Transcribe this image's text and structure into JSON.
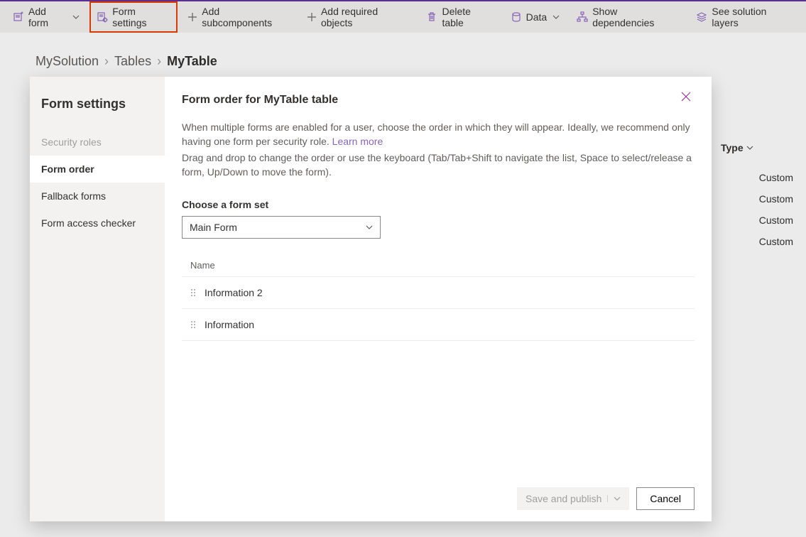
{
  "commandBar": {
    "addForm": "Add form",
    "formSettings": "Form settings",
    "addSubcomponents": "Add subcomponents",
    "addRequiredObjects": "Add required objects",
    "deleteTable": "Delete table",
    "data": "Data",
    "showDependencies": "Show dependencies",
    "seeSolutionLayers": "See solution layers"
  },
  "breadcrumb": {
    "root": "MySolution",
    "mid": "Tables",
    "current": "MyTable"
  },
  "bgTable": {
    "typeHeader": "Type",
    "rows": [
      "Custom",
      "Custom",
      "Custom",
      "Custom"
    ]
  },
  "dialog": {
    "sidebarTitle": "Form settings",
    "sideItems": {
      "security": "Security roles",
      "formOrder": "Form order",
      "fallback": "Fallback forms",
      "accessChecker": "Form access checker"
    },
    "title": "Form order for MyTable table",
    "desc1": "When multiple forms are enabled for a user, choose the order in which they will appear. Ideally, we recommend only having one form per security role. ",
    "learnMore": "Learn more",
    "desc2": "Drag and drop to change the order or use the keyboard (Tab/Tab+Shift to navigate the list, Space to select/release a form, Up/Down to move the form).",
    "formSetLabel": "Choose a form set",
    "formSetValue": "Main Form",
    "listHeader": "Name",
    "listItems": [
      "Information 2",
      "Information"
    ],
    "saveLabel": "Save and publish",
    "cancelLabel": "Cancel"
  }
}
